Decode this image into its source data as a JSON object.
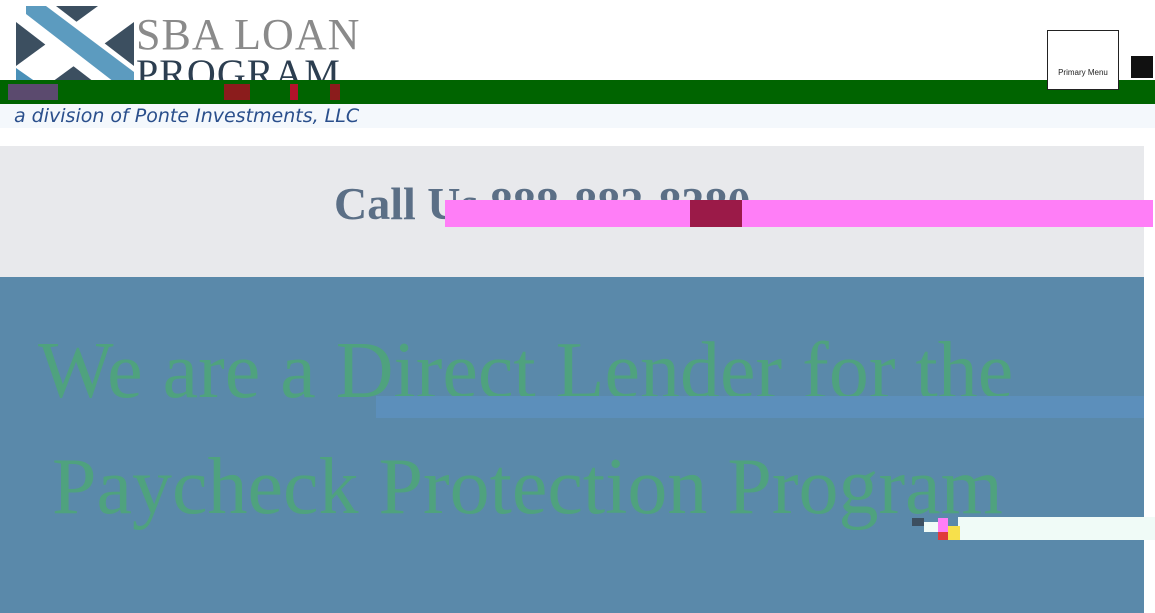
{
  "header": {
    "logo": {
      "line1": "SBA LOAN",
      "line2": "PROGRAM",
      "subline": "a division of Ponte Investments, LLC",
      "colors": {
        "mark_dark": "#3c4f60",
        "mark_blue": "#4a90b8",
        "wordmark": "#8a8a8a"
      }
    },
    "primary_menu_label": "Primary Menu",
    "bar_color": "#006400"
  },
  "call_band": {
    "text": "Call Us 888-882-8380",
    "color": "#5b6f86"
  },
  "hero": {
    "line1": "We are a Direct Lender for the",
    "line2": "Paycheck Protection Program",
    "background": "#5a89aa",
    "text_color": "#4fa27e"
  }
}
